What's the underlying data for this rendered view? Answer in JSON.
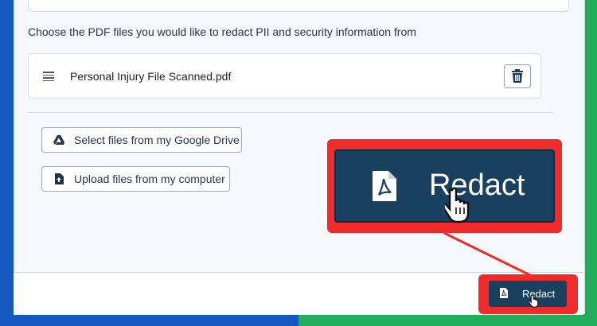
{
  "instructions": "Choose the PDF files you would like to redact PII and security information from",
  "files": [
    {
      "name": "Personal Injury File Scanned.pdf"
    }
  ],
  "buttons": {
    "google_drive": "Select files from my Google Drive",
    "upload": "Upload files from my computer",
    "redact_zoom": "Redact",
    "redact": "Redact"
  },
  "icons": {
    "drag": "drag-handle-icon",
    "delete": "trash-icon",
    "google_drive": "google-drive-icon",
    "upload": "file-upload-icon",
    "pdf": "pdf-file-icon",
    "cursor": "hand-pointer-cursor-icon"
  },
  "colors": {
    "bg_left": "#1359c0",
    "bg_right": "#22ad5c",
    "redact_button": "#19415f",
    "highlight": "#ef2b2b"
  }
}
